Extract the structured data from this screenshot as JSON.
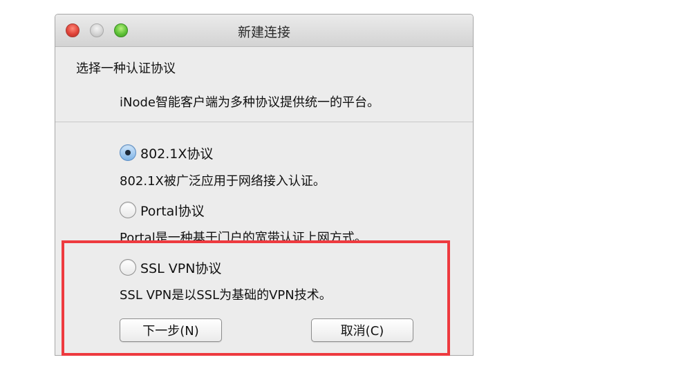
{
  "window": {
    "title": "新建连接"
  },
  "header": {
    "section_title": "选择一种认证协议",
    "description": "iNode智能客户端为多种协议提供统一的平台。"
  },
  "options": [
    {
      "label": "802.1X协议",
      "description": "802.1X被广泛应用于网络接入认证。",
      "selected": true
    },
    {
      "label": "Portal协议",
      "description": "Portal是一种基于门户的宽带认证上网方式。",
      "selected": false
    },
    {
      "label": "SSL VPN协议",
      "description": "SSL VPN是以SSL为基础的VPN技术。",
      "selected": false
    }
  ],
  "buttons": {
    "next_label": "下一步(N)",
    "cancel_label": "取消(C)"
  },
  "colors": {
    "highlight": "#ee3a3f"
  }
}
